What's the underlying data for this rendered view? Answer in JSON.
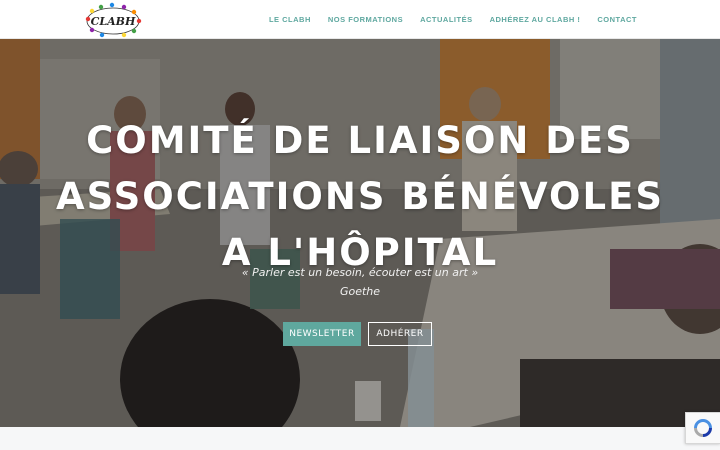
{
  "header": {
    "logo_text": "CLABH",
    "nav": [
      {
        "label": "LE CLABH"
      },
      {
        "label": "NOS FORMATIONS"
      },
      {
        "label": "ACTUALITÉS"
      },
      {
        "label": "ADHÉREZ AU CLABH !"
      },
      {
        "label": "CONTACT"
      }
    ]
  },
  "hero": {
    "title_lines": [
      "COMITÉ DE LIAISON DES",
      "ASSOCIATIONS BÉNÉVOLES",
      "A L'HÔPITAL"
    ],
    "quote": "« Parler est un besoin, écouter est un art »",
    "author": "Goethe",
    "buttons": {
      "newsletter": "NEWSLETTER",
      "adherer": "ADHÉRER"
    }
  },
  "colors": {
    "accent": "#5fa89e",
    "nav_text": "#5fa8a0",
    "header_bg": "#ffffff"
  },
  "icons": {
    "recaptcha": "recaptcha-icon",
    "logo": "clabh-logo"
  }
}
